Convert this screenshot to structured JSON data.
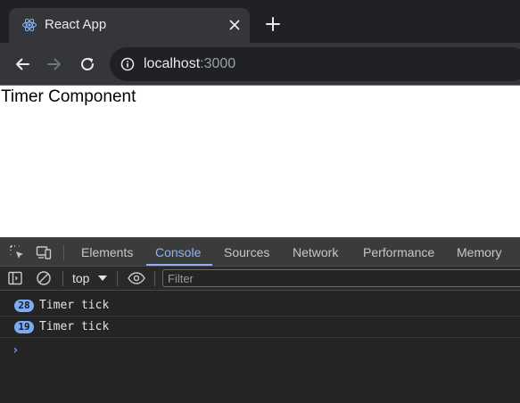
{
  "browser": {
    "tab": {
      "title": "React App",
      "favicon": "react-logo-icon"
    },
    "new_tab_icon": "plus-icon",
    "close_icon": "close-icon",
    "nav": {
      "back": "back-arrow-icon",
      "forward": "forward-arrow-icon",
      "reload": "reload-icon"
    },
    "address": {
      "host": "localhost",
      "port": ":3000",
      "info_icon": "info-icon"
    },
    "colors": {
      "chrome_bg": "#202124",
      "active_tab": "#35363a",
      "text": "#e8eaed",
      "muted": "#9aa0a6"
    }
  },
  "page": {
    "heading": "Timer Component"
  },
  "devtools": {
    "tabs": [
      "Elements",
      "Console",
      "Sources",
      "Network",
      "Performance",
      "Memory"
    ],
    "active_tab": "Console",
    "accent": "#8ab4f8",
    "console_toolbar": {
      "context": "top",
      "filter_placeholder": "Filter"
    },
    "messages": [
      {
        "count": "28",
        "text": "Timer tick"
      },
      {
        "count": "19",
        "text": "Timer tick"
      }
    ],
    "prompt": "›"
  }
}
